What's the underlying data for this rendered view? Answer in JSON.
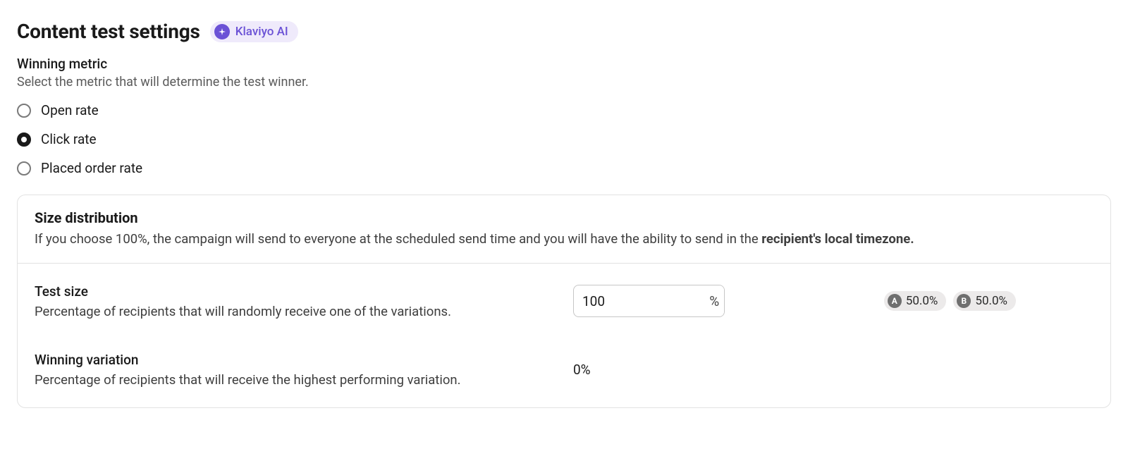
{
  "header": {
    "title": "Content test settings",
    "ai_badge": "Klaviyo AI"
  },
  "winning_metric": {
    "label": "Winning metric",
    "help": "Select the metric that will determine the test winner.",
    "options": [
      {
        "label": "Open rate",
        "selected": false
      },
      {
        "label": "Click rate",
        "selected": true
      },
      {
        "label": "Placed order rate",
        "selected": false
      }
    ]
  },
  "size_distribution": {
    "title": "Size distribution",
    "desc_prefix": "If you choose 100%, the campaign will send to everyone at the scheduled send time and you will have the ability to send in the ",
    "desc_bold": "recipient's local timezone."
  },
  "test_size": {
    "label": "Test size",
    "help": "Percentage of recipients that will randomly receive one of the variations.",
    "value": "100",
    "suffix": "%",
    "variants": [
      {
        "letter": "A",
        "share": "50.0%"
      },
      {
        "letter": "B",
        "share": "50.0%"
      }
    ]
  },
  "winning_variation": {
    "label": "Winning variation",
    "help": "Percentage of recipients that will receive the highest performing variation.",
    "value": "0%"
  }
}
